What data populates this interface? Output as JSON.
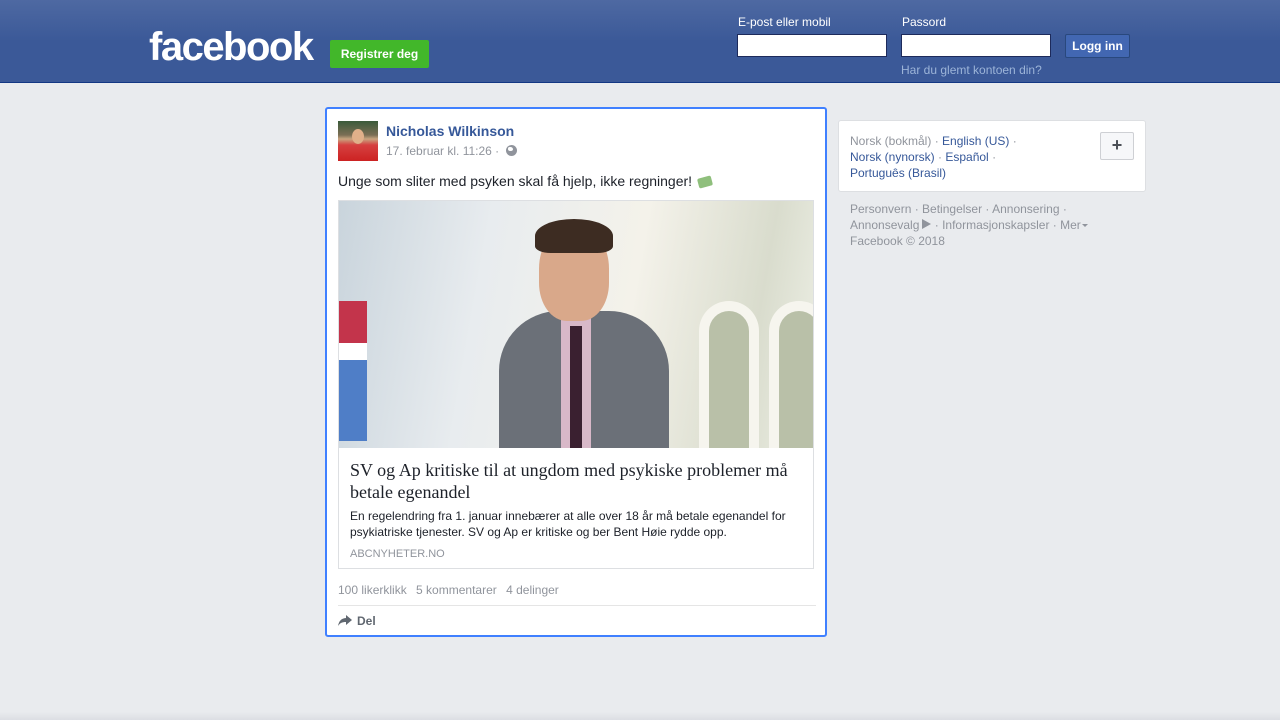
{
  "header": {
    "logo_text": "facebook",
    "register_label": "Registrer deg",
    "email_label": "E-post eller mobil",
    "password_label": "Passord",
    "login_label": "Logg inn",
    "forgot_label": "Har du glemt kontoen din?"
  },
  "post": {
    "author": "Nicholas Wilkinson",
    "timestamp": "17. februar kl. 11:26 ·",
    "text": "Unge som sliter med psyken skal få hjelp, ikke regninger!",
    "link": {
      "title": "SV og Ap kritiske til at ungdom med psykiske problemer må betale egenandel",
      "description": "En regelendring fra 1. januar innebærer at alle over 18 år må betale egenandel for psykiatriske tjenester. SV og Ap er kritiske og ber Bent Høie rydde opp.",
      "domain": "ABCNYHETER.NO"
    },
    "stats": {
      "likes": "100 likerklikk",
      "comments": "5 kommentarer",
      "shares": "4 delinger"
    },
    "share_label": "Del"
  },
  "sidebar": {
    "languages": {
      "current": "Norsk (bokmål)",
      "items": [
        "English (US)",
        "Norsk (nynorsk)",
        "Español",
        "Português (Brasil)"
      ]
    },
    "add_language_label": "+",
    "footer": {
      "privacy": "Personvern",
      "terms": "Betingelser",
      "advertising": "Annonsering",
      "adchoices": "Annonsevalg",
      "cookies": "Informasjonskapsler",
      "more": "Mer",
      "copyright": "Facebook © 2018"
    }
  },
  "colors": {
    "header_blue": "#3b5998",
    "link_blue": "#365899",
    "register_green": "#42b72a",
    "focus_border": "#4080ff"
  }
}
